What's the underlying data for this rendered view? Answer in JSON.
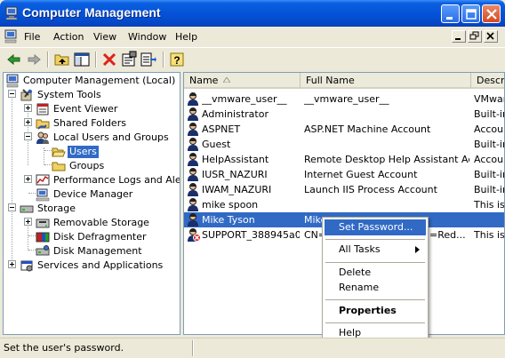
{
  "window": {
    "title": "Computer Management",
    "controls": [
      "minimize-icon",
      "maximize-icon",
      "close-icon"
    ]
  },
  "menubar": {
    "items": [
      "File",
      "Action",
      "View",
      "Window",
      "Help"
    ]
  },
  "toolbar": {
    "icons": [
      "back-arrow-icon",
      "forward-arrow-icon",
      "up-folder-icon",
      "show-hide-tree-icon",
      "delete-icon",
      "properties-icon",
      "export-list-icon",
      "help-icon"
    ]
  },
  "tree": {
    "items": [
      {
        "label": "Computer Management (Local)",
        "icon": "computer-management-icon"
      },
      {
        "label": "System Tools",
        "icon": "system-tools-icon"
      },
      {
        "label": "Event Viewer",
        "icon": "event-viewer-icon"
      },
      {
        "label": "Shared Folders",
        "icon": "shared-folders-icon"
      },
      {
        "label": "Local Users and Groups",
        "icon": "users-groups-icon"
      },
      {
        "label": "Users",
        "icon": "folder-open-icon"
      },
      {
        "label": "Groups",
        "icon": "folder-icon"
      },
      {
        "label": "Performance Logs and Alerts",
        "icon": "performance-logs-icon"
      },
      {
        "label": "Device Manager",
        "icon": "device-manager-icon"
      },
      {
        "label": "Storage",
        "icon": "storage-icon"
      },
      {
        "label": "Removable Storage",
        "icon": "removable-storage-icon"
      },
      {
        "label": "Disk Defragmenter",
        "icon": "disk-defragmenter-icon"
      },
      {
        "label": "Disk Management",
        "icon": "disk-management-icon"
      },
      {
        "label": "Services and Applications",
        "icon": "services-applications-icon"
      }
    ],
    "selected": "Users"
  },
  "list": {
    "columns": [
      "Name",
      "Full Name",
      "Descri"
    ],
    "rows": [
      {
        "name": "__vmware_user__",
        "full_name": "__vmware_user__",
        "description": "VMwar",
        "disabled": false
      },
      {
        "name": "Administrator",
        "full_name": "",
        "description": "Built-in",
        "disabled": false
      },
      {
        "name": "ASPNET",
        "full_name": "ASP.NET Machine Account",
        "description": "Accoun",
        "disabled": false
      },
      {
        "name": "Guest",
        "full_name": "",
        "description": "Built-in",
        "disabled": false
      },
      {
        "name": "HelpAssistant",
        "full_name": "Remote Desktop Help Assistant Ac...",
        "description": "Accoun",
        "disabled": false
      },
      {
        "name": "IUSR_NAZURI",
        "full_name": "Internet Guest Account",
        "description": "Built-in",
        "disabled": false
      },
      {
        "name": "IWAM_NAZURI",
        "full_name": "Launch IIS Process Account",
        "description": "Built-in",
        "disabled": false
      },
      {
        "name": "mike spoon",
        "full_name": "",
        "description": "This is",
        "disabled": false
      },
      {
        "name": "Mike Tyson",
        "full_name": "Mike",
        "description": "",
        "disabled": false
      },
      {
        "name": "SUPPORT_388945a0",
        "full_name": "CN=",
        "description": "This is",
        "disabled": true
      }
    ],
    "support_fullname_tail": "=Red...",
    "selected": "Mike Tyson"
  },
  "context_menu": {
    "items": [
      "Set Password...",
      "All Tasks",
      "Delete",
      "Rename",
      "Properties",
      "Help"
    ],
    "highlighted": "Set Password..."
  },
  "statusbar": {
    "text": "Set the user's password."
  },
  "colors": {
    "titlebar": "#0553d8",
    "selection": "#316ac5",
    "chrome": "#ece9d8"
  }
}
